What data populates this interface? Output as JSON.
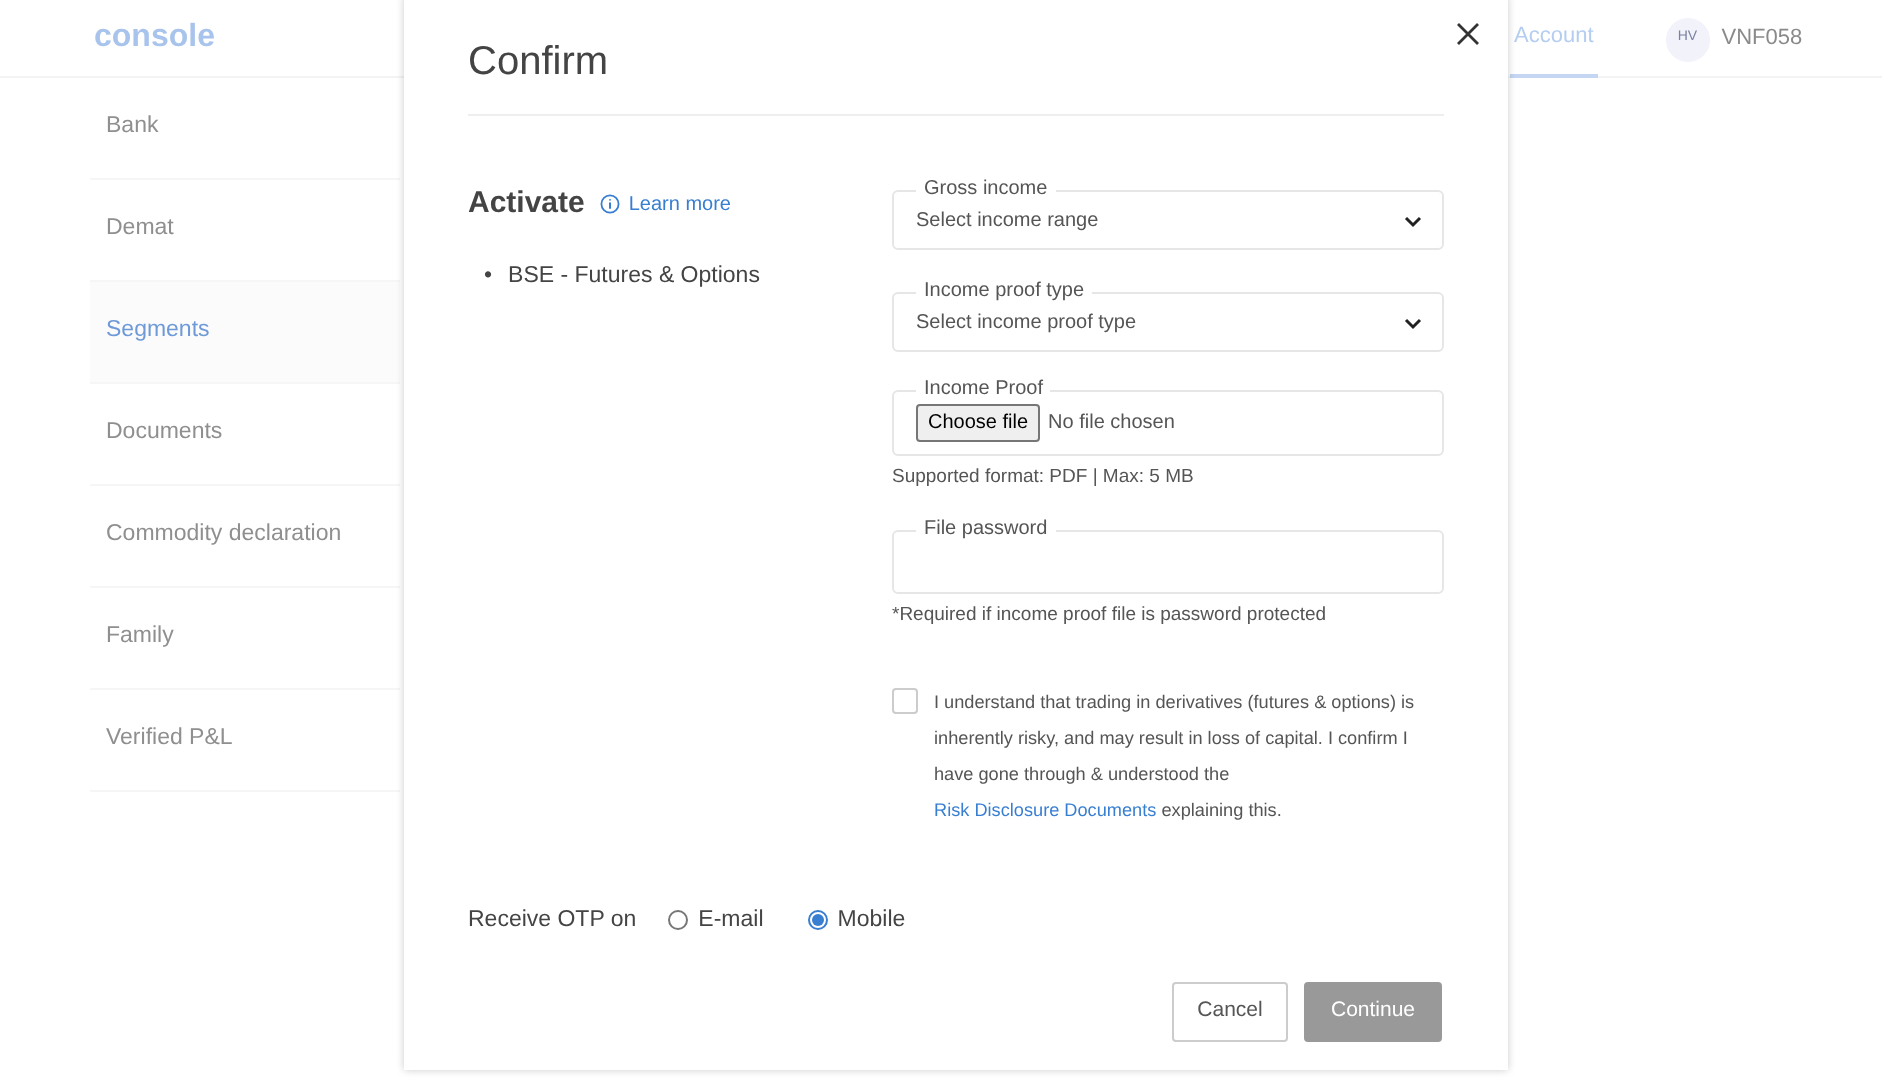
{
  "app": {
    "logo": "console",
    "nav": [
      {
        "label": "Account",
        "selected": true
      }
    ],
    "avatar": "HV",
    "user_id": "VNF058"
  },
  "sidebar": {
    "items": [
      {
        "label": "Bank",
        "selected": false
      },
      {
        "label": "Demat",
        "selected": false
      },
      {
        "label": "Segments",
        "selected": true
      },
      {
        "label": "Documents",
        "selected": false
      },
      {
        "label": "Commodity declaration",
        "selected": false
      },
      {
        "label": "Family",
        "selected": false
      },
      {
        "label": "Verified P&L",
        "selected": false
      }
    ]
  },
  "modal": {
    "title": "Confirm",
    "heading": "Activate",
    "learn_more": "Learn more",
    "segments": [
      {
        "bullet": "•",
        "label": "BSE - Futures & Options"
      }
    ],
    "fields": [
      {
        "kind": "select",
        "label": "Gross income",
        "value": "Select income range"
      },
      {
        "kind": "select",
        "label": "Income proof type",
        "value": "Select income proof type"
      },
      {
        "kind": "file",
        "label": "Income Proof",
        "button": "Choose file",
        "value": "No file chosen",
        "note": "Supported format: PDF | Max: 5 MB"
      },
      {
        "kind": "password",
        "label": "File password",
        "note": "*Required if income proof file is password protected"
      }
    ],
    "consent": {
      "checked": false,
      "text": "I understand that trading in derivatives (futures & options) is inherently risky, and may result in loss of capital. I confirm I have gone through & understood the ",
      "link": "Risk Disclosure Documents",
      "text_after": " explaining this."
    },
    "otp": {
      "label": "Receive OTP on",
      "options": [
        {
          "label": "E-mail",
          "selected": false
        },
        {
          "label": "Mobile",
          "selected": true
        }
      ]
    },
    "buttons": [
      {
        "kind": "secondary",
        "label": "Cancel"
      },
      {
        "kind": "primary",
        "label": "Continue",
        "disabled": true
      }
    ]
  }
}
